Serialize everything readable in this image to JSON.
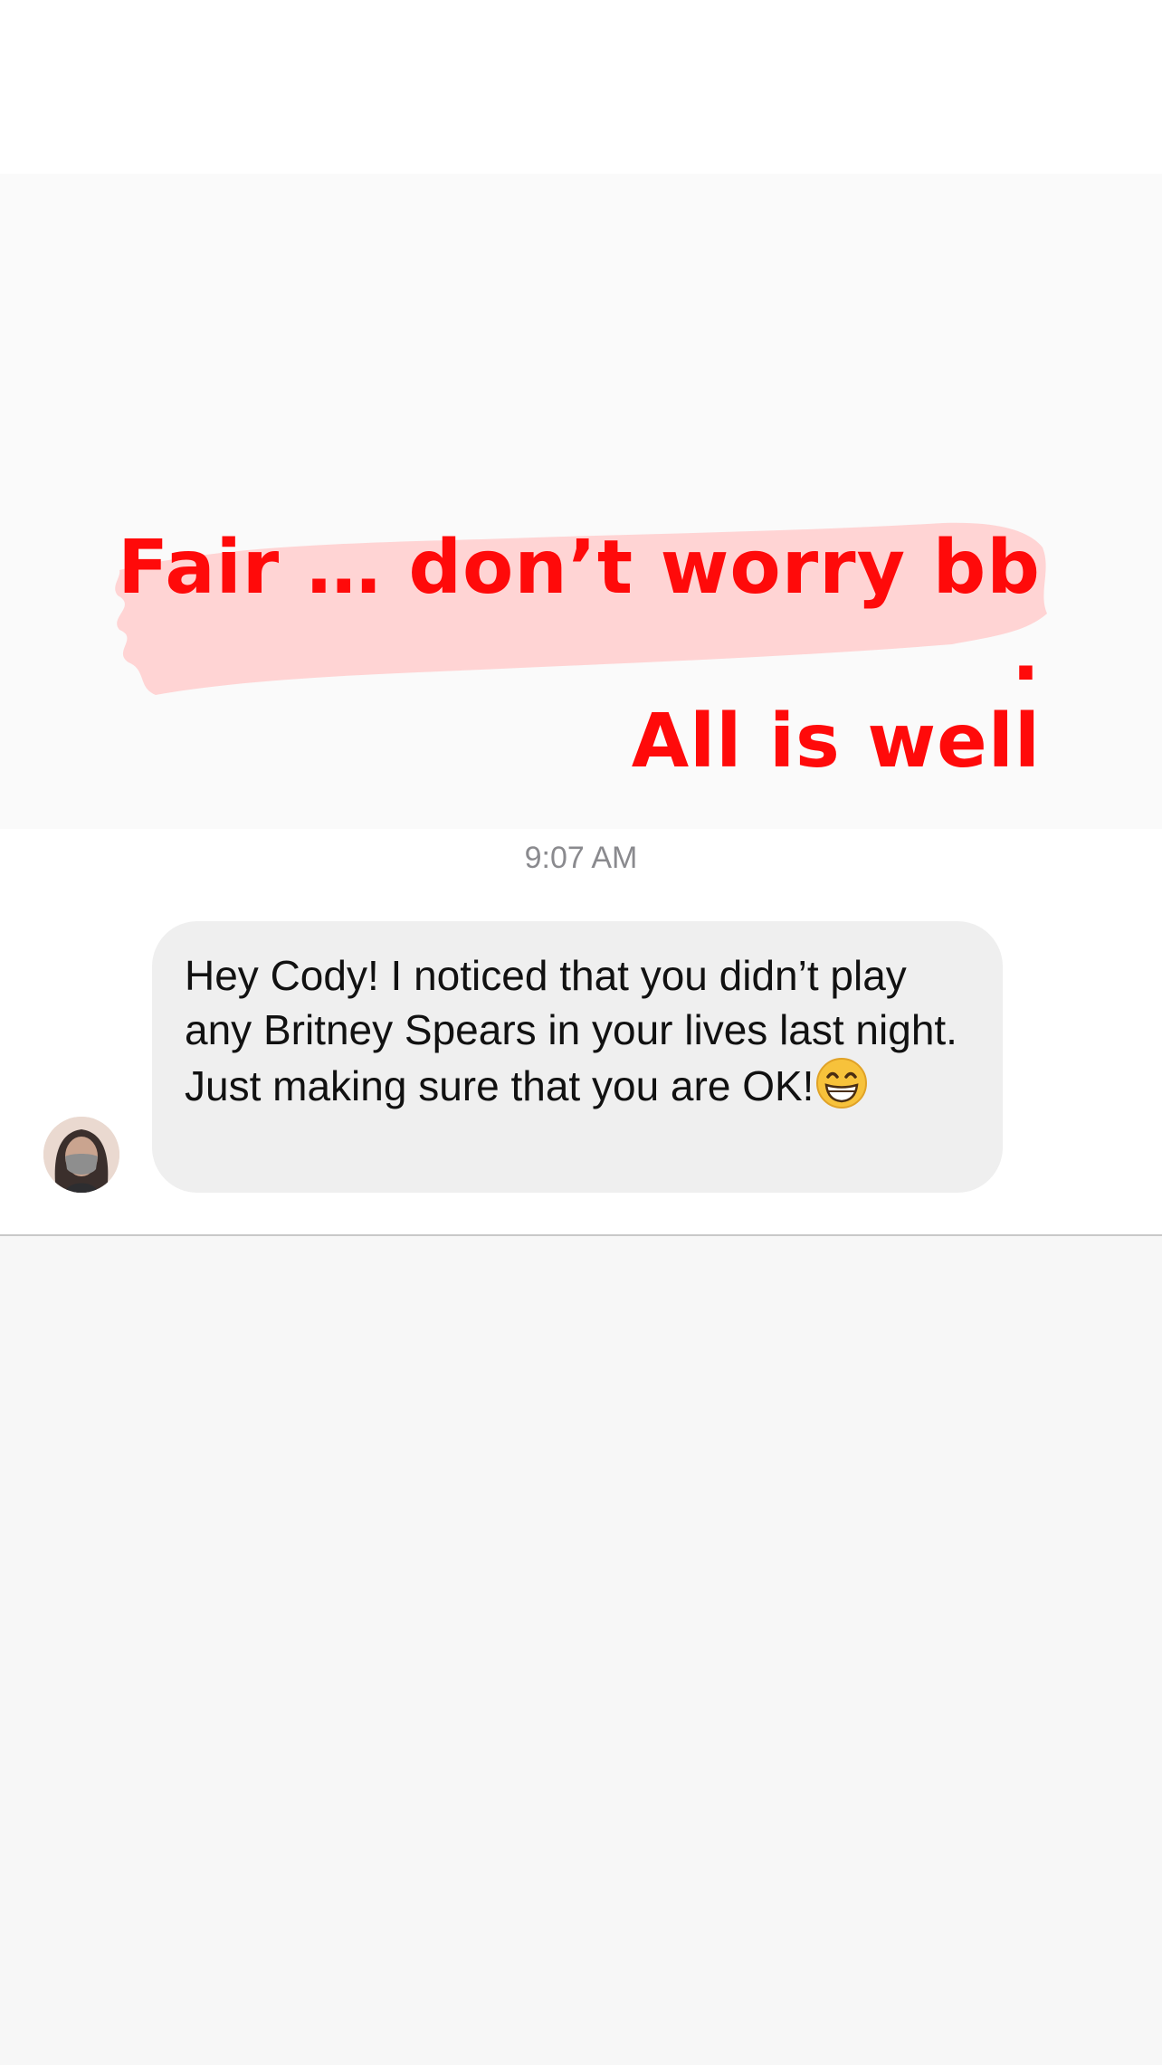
{
  "story_overlay": {
    "line1": "Fair … don’t worry bb .",
    "line2": "All is well",
    "text_color": "#ff0a0a",
    "highlight_color": "#ffd4d4"
  },
  "chat": {
    "timestamp": "9:07 AM",
    "message": {
      "text": "Hey Cody! I noticed that you didn’t play any Britney Spears in your lives last night. Just making sure that you are OK!",
      "emoji": "grinning-face-with-smiling-eyes",
      "bubble_color": "#efefef"
    },
    "sender_avatar": "masked-person-avatar"
  }
}
